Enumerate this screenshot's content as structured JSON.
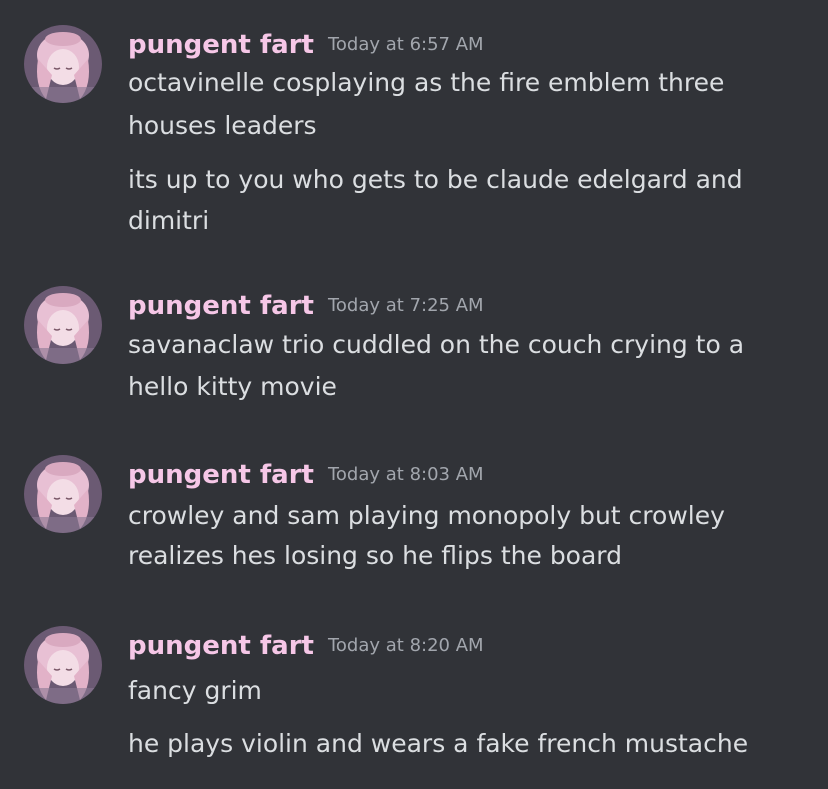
{
  "colors": {
    "background": "#313338",
    "username": "#f6c7e7",
    "timestamp": "#a2a6ad",
    "message_text": "#dbdee1"
  },
  "messages": [
    {
      "author": "pungent fart",
      "timestamp": "Today at 6:57 AM",
      "lines": [
        "octavinelle cosplaying as the fire emblem three",
        "houses leaders",
        "its up to you who gets to be claude edelgard and",
        "dimitri"
      ]
    },
    {
      "author": "pungent fart",
      "timestamp": "Today at 7:25 AM",
      "lines": [
        "savanaclaw trio cuddled on the couch crying to a",
        "hello kitty movie"
      ]
    },
    {
      "author": "pungent fart",
      "timestamp": "Today at 8:03 AM",
      "lines": [
        "crowley and sam playing monopoly but crowley",
        "realizes hes losing so he flips the board"
      ]
    },
    {
      "author": "pungent fart",
      "timestamp": "Today at 8:20 AM",
      "lines": [
        "fancy grim",
        "he plays violin and wears a fake french mustache"
      ]
    }
  ]
}
